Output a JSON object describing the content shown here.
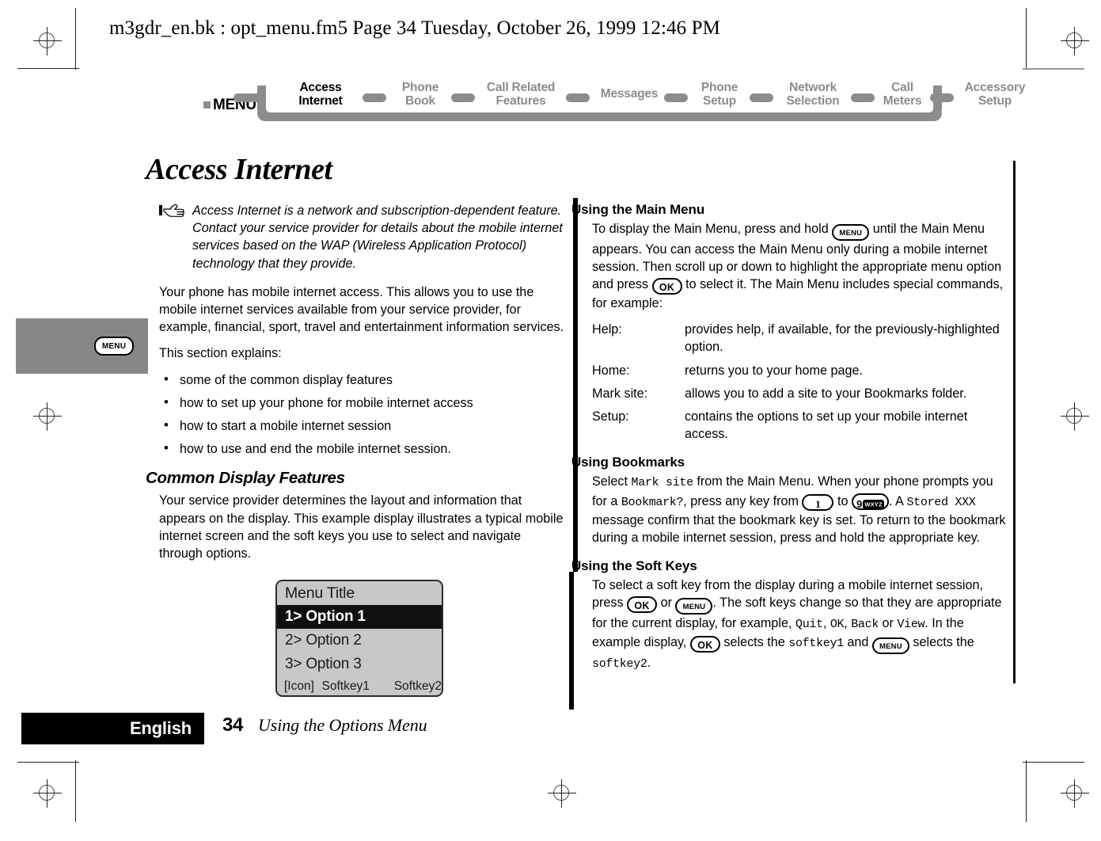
{
  "document": {
    "header_line": "m3gdr_en.bk : opt_menu.fm5  Page 34  Tuesday, October 26, 1999  12:46 PM",
    "page_title": "Access Internet"
  },
  "menu_map": {
    "menu_label": "MENU",
    "items": [
      {
        "line1": "Access",
        "line2": "Internet",
        "current": true
      },
      {
        "line1": "Phone",
        "line2": "Book",
        "current": false
      },
      {
        "line1": "Call Related",
        "line2": "Features",
        "current": false
      },
      {
        "line1": "Messages",
        "line2": "",
        "current": false
      },
      {
        "line1": "Phone",
        "line2": "Setup",
        "current": false
      },
      {
        "line1": "Network",
        "line2": "Selection",
        "current": false
      },
      {
        "line1": "Call",
        "line2": "Meters",
        "current": false
      },
      {
        "line1": "Accessory",
        "line2": "Setup",
        "current": false
      }
    ]
  },
  "margin_tab": {
    "key_label": "MENU"
  },
  "left_column": {
    "note": "Access Internet is a network and subscription-dependent feature. Contact your service provider for details about the mobile internet services based on the WAP (Wireless Application Protocol) technology that they provide.",
    "para1": "Your phone has mobile internet access. This allows you to use the mobile internet services available from your service provider, for example, financial, sport, travel and entertainment information services.",
    "para2": "This section explains:",
    "bullets": [
      "some of the common display features",
      "how to set up your phone for mobile internet access",
      "how to start a mobile internet session",
      "how to use and end the mobile internet session."
    ],
    "section_heading": "Common Display Features",
    "para3": "Your service provider determines the layout and information that appears on the display. This example display illustrates a typical mobile internet screen and the soft keys you use to select and navigate through options."
  },
  "phone_display": {
    "title": "Menu Title",
    "rows": [
      {
        "label": "1> Option 1",
        "selected": true
      },
      {
        "label": "2> Option 2",
        "selected": false
      },
      {
        "label": "3> Option 3",
        "selected": false
      }
    ],
    "softbar": {
      "icon": "[Icon]",
      "softkey1": "Softkey1",
      "softkey2": "Softkey2"
    }
  },
  "right_column": {
    "main_menu": {
      "heading": "Using the Main Menu",
      "text_a": "To display the Main Menu, press and hold ",
      "key1": "MENU",
      "text_b": " until the Main Menu appears. You can access the Main Menu only during a mobile internet session. Then scroll up or down to highlight the appropriate menu option and press ",
      "key2": "OK",
      "text_c": " to select it. The Main Menu includes special commands, for example:",
      "definitions": [
        {
          "term": "Help:",
          "desc": "provides help, if available, for the previously-highlighted option."
        },
        {
          "term": "Home:",
          "desc": "returns you to your home page."
        },
        {
          "term": "Mark site:",
          "desc": "allows you to add a site to your Bookmarks folder."
        },
        {
          "term": "Setup:",
          "desc": "contains the options to set up your mobile internet access."
        }
      ]
    },
    "bookmarks": {
      "heading": "Using Bookmarks",
      "t1": "Select ",
      "lcd1": "Mark site",
      "t2": " from the Main Menu. When your phone prompts you for a ",
      "lcd2": "Bookmark?",
      "t3": ", press any key from ",
      "key_low": "1",
      "t4": " to ",
      "key_high_digit": "9",
      "key_high_letters": "WXYZ",
      "t5": ". A ",
      "lcd3": "Stored XXX",
      "t6": " message confirm that the bookmark key is set. To return to the bookmark during a mobile internet session, press and hold the appropriate key."
    },
    "soft_keys": {
      "heading": "Using the Soft Keys",
      "t1": "To select a soft key from the display during a mobile internet session, press ",
      "key_ok_1": "OK",
      "t2": " or ",
      "key_menu_1": "MENU",
      "t3": ". The soft keys change so that they are appropriate for the current display, for example, ",
      "lcd_quit": "Quit",
      "t4": ", ",
      "lcd_ok": "OK",
      "t5": ", ",
      "lcd_back": "Back",
      "t6": " or ",
      "lcd_view": "View",
      "t7": ". In the example display, ",
      "key_ok_2": "OK",
      "t8": " selects the ",
      "lcd_sk1": "softkey1",
      "t9": " and ",
      "key_menu_2": "MENU",
      "t10": " selects the ",
      "lcd_sk2": "softkey2",
      "t11": "."
    }
  },
  "footer": {
    "language": "English",
    "page_number": "34",
    "section": "Using the Options Menu"
  },
  "colors": {
    "menu_map_gray": "#8c8c8c",
    "margin_tab_gray": "#878787",
    "display_bg": "#c8c8c8",
    "highlight": "#101010"
  }
}
